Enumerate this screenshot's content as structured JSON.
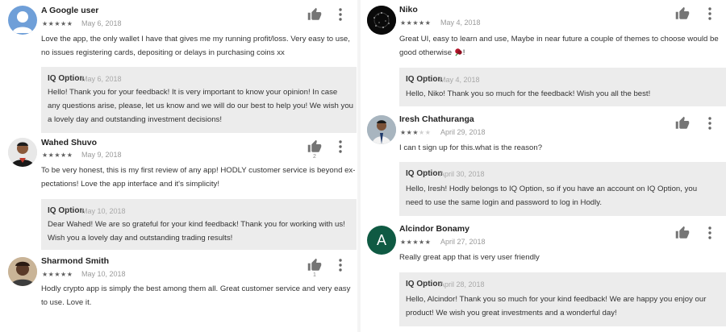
{
  "left_column": {
    "reviews": [
      {
        "author": "A Google user",
        "stars": "★★★★★",
        "date": "May 6, 2018",
        "lines": [
          "Love the app, the only wallet I have that gives me my running profit/loss. Very easy to use,",
          "no issues registering cards, depositing or delays in purchasing coins xx"
        ],
        "helpful_count": "",
        "reply": {
          "author": "IQ Option",
          "date": "May 6, 2018",
          "lines": [
            "Hello! Thank you for your feedback! It is very important to know your opinion! In case",
            "any questions arise, please, let us know and we will do our best to help you! We wish you",
            "a lovely day and outstanding investment decisions!"
          ]
        }
      },
      {
        "author": "Wahed Shuvo",
        "stars": "★★★★★",
        "date": "May 9, 2018",
        "lines": [
          "To be very honest, this is my first review of any app! HODLY customer service is beyond ex-",
          "pectations! Love the app interface and it's simplicity!"
        ],
        "helpful_count": "2",
        "reply": {
          "author": "IQ Option",
          "date": "May 10, 2018",
          "lines": [
            "Dear Wahed! We are so grateful for your kind feedback! Thank you for working with us!",
            "Wish you a lovely day and outstanding trading results!"
          ]
        }
      },
      {
        "author": "Sharmond Smith",
        "stars": "★★★★★",
        "date": "May 10, 2018",
        "lines": [
          "Hodly crypto app is simply the best among them all. Great customer service and very easy",
          "to use. Love it."
        ],
        "helpful_count": "1"
      }
    ]
  },
  "right_column": {
    "reviews": [
      {
        "author": "Niko",
        "stars": "★★★★★",
        "date": "May 4, 2018",
        "lines": [
          "Great UI, easy to learn and use, Maybe in near future a couple of themes to choose would be",
          "good otherwise"
        ],
        "trailing_text": "!",
        "helpful_count": "",
        "reply": {
          "author": "IQ Option",
          "date": "May 4, 2018",
          "lines": [
            "Hello, Niko! Thank you so much for the feedback! Wish you all the best!"
          ]
        }
      },
      {
        "author": "Iresh Chathuranga",
        "stars": "★★★",
        "stars_off": "★★",
        "date": "April 29, 2018",
        "lines": [
          "I can t sign up for this.what is the reason?"
        ],
        "helpful_count": "",
        "reply": {
          "author": "IQ Option",
          "date": "April 30, 2018",
          "lines": [
            "Hello, Iresh! Hodly belongs to IQ Option, so if you have an account on IQ Option, you",
            "need to use the same login and password to log in Hodly."
          ]
        }
      },
      {
        "author": "Alcindor Bonamy",
        "avatar_letter": "A",
        "stars": "★★★★★",
        "date": "April 27, 2018",
        "lines": [
          "Really great app that is very user friendly"
        ],
        "helpful_count": "",
        "reply": {
          "author": "IQ Option",
          "date": "April 28, 2018",
          "lines": [
            "Hello, Alcindor! Thank you so much for your kind feedback! We are happy you enjoy our",
            "product! We wish you great investments and a wonderful day!"
          ]
        }
      }
    ]
  },
  "icons": {
    "helpful": "thumbs-up-icon",
    "menu": "more-vert-icon"
  },
  "colors": {
    "reply_bg": "#ececec",
    "alcindor_avatar": "#0f5a43",
    "google_avatar": "#6f9fd8"
  }
}
